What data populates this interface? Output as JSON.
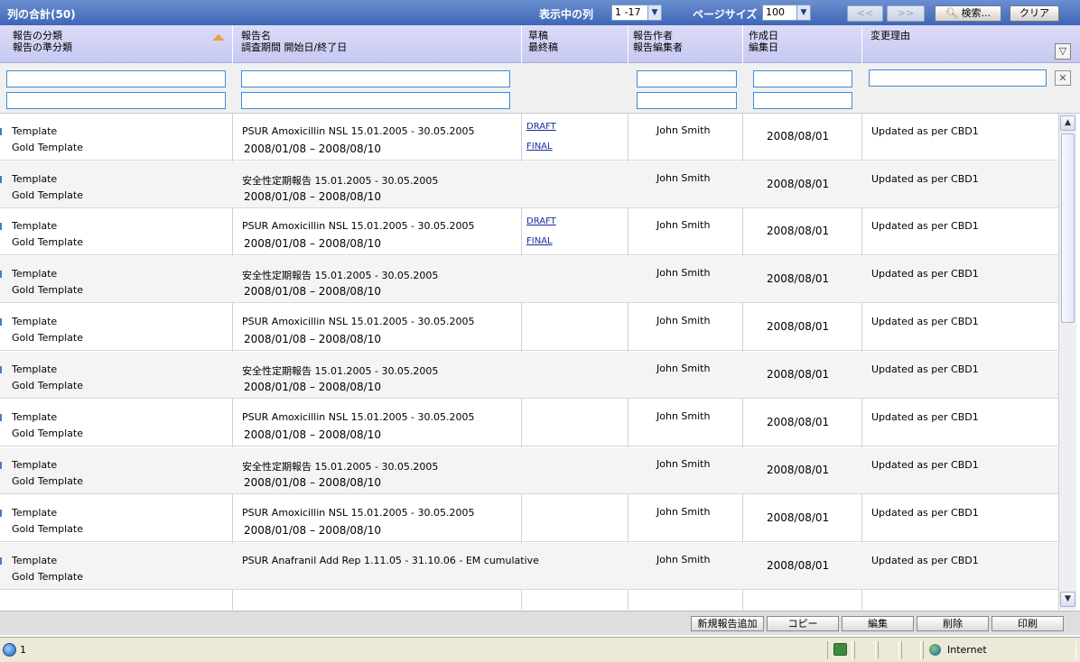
{
  "titlebar": {
    "total_label": "列の合計(50)",
    "columns_label": "表示中の列",
    "columns_value": "1 -17",
    "pagesize_label": "ページサイズ",
    "pagesize_value": "100",
    "prev_label": "<<",
    "next_label": ">>",
    "search_label": "検索...",
    "clear_label": "クリア"
  },
  "header": {
    "col1_line1": "報告の分類",
    "col1_line2": "報告の準分類",
    "col2_line1": "報告名",
    "col2_line2": "調査期間  開始日/終了日",
    "col3_line1": "草稿",
    "col3_line2": "最終稿",
    "col4_line1": "報告作者",
    "col4_line2": "報告編集者",
    "col5_line1": "作成日",
    "col5_line2": "編集日",
    "col6_line1": "変更理由"
  },
  "rows": [
    {
      "category": "Template",
      "subcategory": "Gold Template",
      "name": "PSUR Amoxicillin NSL 15.01.2005 - 30.05.2005",
      "period": "2008/01/08  –  2008/08/10",
      "draft": "DRAFT",
      "final": "FINAL",
      "author": "John Smith",
      "date": "2008/08/01",
      "reason": "Updated as per CBD1"
    },
    {
      "category": "Template",
      "subcategory": "Gold Template",
      "name": "安全性定期報告         15.01.2005 - 30.05.2005",
      "period": "2008/01/08 – 2008/08/10",
      "draft": "",
      "final": "",
      "author": "John Smith",
      "date": "2008/08/01",
      "reason": "Updated as per CBD1"
    },
    {
      "category": "Template",
      "subcategory": "Gold Template",
      "name": "PSUR Amoxicillin NSL 15.01.2005 - 30.05.2005",
      "period": "2008/01/08  –  2008/08/10",
      "draft": "DRAFT",
      "final": "FINAL",
      "author": "John Smith",
      "date": "2008/08/01",
      "reason": "Updated as per CBD1"
    },
    {
      "category": "Template",
      "subcategory": "Gold Template",
      "name": "安全性定期報告         15.01.2005 - 30.05.2005",
      "period": "2008/01/08 – 2008/08/10",
      "draft": "",
      "final": "",
      "author": "John Smith",
      "date": "2008/08/01",
      "reason": "Updated as per CBD1"
    },
    {
      "category": "Template",
      "subcategory": "Gold Template",
      "name": "PSUR Amoxicillin NSL 15.01.2005 - 30.05.2005",
      "period": "2008/01/08  –  2008/08/10",
      "draft": "",
      "final": "",
      "author": "John Smith",
      "date": "2008/08/01",
      "reason": "Updated as per CBD1"
    },
    {
      "category": "Template",
      "subcategory": "Gold Template",
      "name": "安全性定期報告         15.01.2005 - 30.05.2005",
      "period": "2008/01/08 – 2008/08/10",
      "draft": "",
      "final": "",
      "author": "John Smith",
      "date": "2008/08/01",
      "reason": "Updated as per CBD1"
    },
    {
      "category": "Template",
      "subcategory": "Gold Template",
      "name": "PSUR Amoxicillin NSL 15.01.2005 - 30.05.2005",
      "period": "2008/01/08  –  2008/08/10",
      "draft": "",
      "final": "",
      "author": "John Smith",
      "date": "2008/08/01",
      "reason": "Updated as per CBD1"
    },
    {
      "category": "Template",
      "subcategory": "Gold Template",
      "name": "安全性定期報告         15.01.2005 - 30.05.2005",
      "period": "2008/01/08 – 2008/08/10",
      "draft": "",
      "final": "",
      "author": "John Smith",
      "date": "2008/08/01",
      "reason": "Updated as per CBD1"
    },
    {
      "category": "Template",
      "subcategory": "Gold Template",
      "name": "PSUR Amoxicillin NSL 15.01.2005 - 30.05.2005",
      "period": "2008/01/08  –  2008/08/10",
      "draft": "",
      "final": "",
      "author": "John Smith",
      "date": "2008/08/01",
      "reason": "Updated as per CBD1"
    },
    {
      "category": "Template",
      "subcategory": "Gold Template",
      "name": "PSUR Anafranil Add Rep 1.11.05 - 31.10.06 - EM cumulative",
      "period": "",
      "draft": "",
      "final": "",
      "author": "John Smith",
      "date": "2008/08/01",
      "reason": "Updated as per CBD1"
    }
  ],
  "actions": {
    "add_label": "新規報告追加",
    "copy_label": "コピー",
    "edit_label": "編集",
    "delete_label": "削除",
    "print_label": "印刷"
  },
  "statusbar": {
    "page_text": "1",
    "zone_text": "Internet"
  },
  "icons": {
    "sort": "sort-ascending-icon",
    "filter": "filter-icon",
    "clear_filter": "close-icon",
    "search": "magnifier-icon",
    "ie": "ie-page-icon",
    "zone": "globe-icon"
  },
  "colors": {
    "titlebar": "#4a72c0",
    "header": "#d0d2f5",
    "link": "#1a2aa0",
    "sort_arrow": "#f0a040"
  }
}
